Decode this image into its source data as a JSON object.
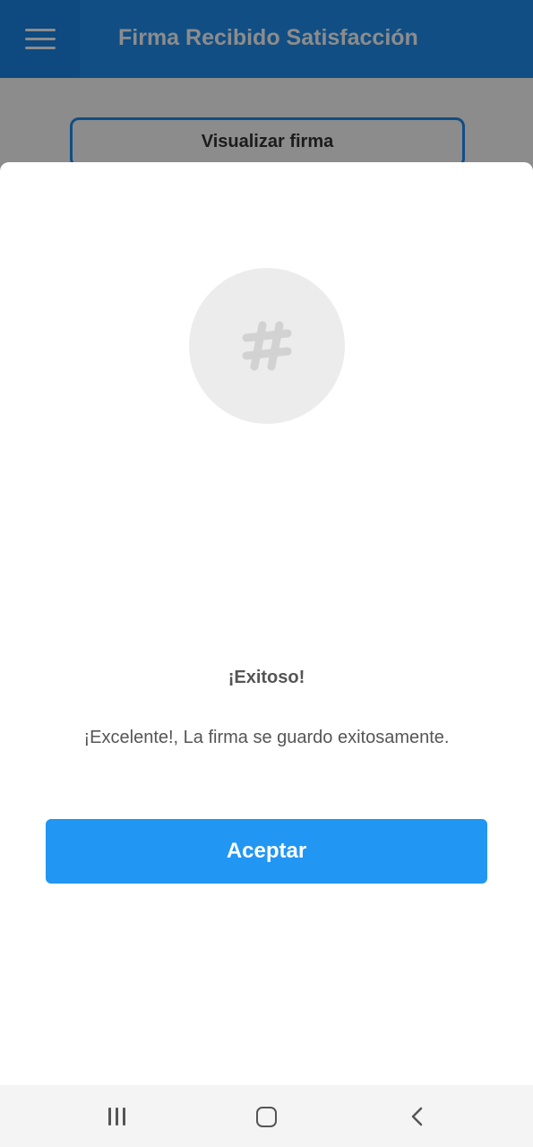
{
  "app_bar": {
    "title": "Firma Recibido Satisfacción",
    "menu_icon": "hamburger-menu-icon"
  },
  "background": {
    "visualize_button_label": "Visualizar firma"
  },
  "dialog": {
    "icon": "hash-icon",
    "title": "¡Exitoso!",
    "message": "¡Excelente!, La firma se guardo exitosamente.",
    "accept_label": "Aceptar"
  },
  "nav_bar": {
    "recents_icon": "recents-icon",
    "home_icon": "home-icon",
    "back_icon": "back-icon"
  },
  "colors": {
    "primary": "#1f8ff0",
    "accept_button": "#2196f3",
    "icon_circle": "#ececec",
    "text_gray": "#555555"
  }
}
